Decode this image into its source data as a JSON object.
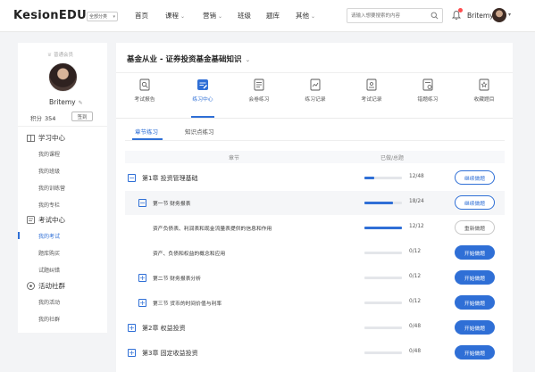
{
  "header": {
    "logo": "KesionEDU",
    "category_select": "全部分类",
    "nav": [
      {
        "label": "首页",
        "has_menu": false
      },
      {
        "label": "课程",
        "has_menu": true
      },
      {
        "label": "营销",
        "has_menu": true
      },
      {
        "label": "班级",
        "has_menu": false
      },
      {
        "label": "题库",
        "has_menu": false
      },
      {
        "label": "其他",
        "has_menu": true
      }
    ],
    "search_placeholder": "请输入想要搜索的内容",
    "username": "Britemy"
  },
  "sidebar": {
    "vip_label": "普通会员",
    "username": "Britemy",
    "points_label": "积分",
    "points_value": "354",
    "checkin_label": "签到",
    "sections": [
      {
        "title": "学习中心",
        "icon": "book-icon",
        "items": [
          "我的课程",
          "我的班级",
          "我的训练营",
          "我的专栏"
        ]
      },
      {
        "title": "考试中心",
        "icon": "exam-icon",
        "items": [
          "我的考试",
          "题库购买",
          "试题纠错"
        ]
      },
      {
        "title": "活动社群",
        "icon": "community-icon",
        "items": [
          "我的活动",
          "我的社群"
        ]
      }
    ],
    "active_item": "我的考试"
  },
  "main": {
    "course_title": "基金从业 - 证券投资基金基础知识",
    "icon_tabs": [
      {
        "label": "考试报告",
        "icon": "report-icon"
      },
      {
        "label": "练习中心",
        "icon": "practice-icon"
      },
      {
        "label": "会卷练习",
        "icon": "paper-icon"
      },
      {
        "label": "练习记录",
        "icon": "record-icon"
      },
      {
        "label": "考试记录",
        "icon": "exam-record-icon"
      },
      {
        "label": "错题练习",
        "icon": "wrong-icon"
      },
      {
        "label": "收藏题目",
        "icon": "bookmark-icon"
      }
    ],
    "active_icon_tab": "练习中心",
    "sub_tabs": [
      "章节练习",
      "知识点练习"
    ],
    "active_sub_tab": "章节练习",
    "table_headers": {
      "chapter": "章节",
      "progress": "已做/总题"
    },
    "rows": [
      {
        "level": 1,
        "expander": "−",
        "name": "第1章 投资管理基础",
        "done": 12,
        "total": 48,
        "count": "12/48",
        "button": "继续做题",
        "button_type": "continue",
        "shade": false
      },
      {
        "level": 2,
        "expander": "−",
        "name": "第一节 财务报表",
        "done": 18,
        "total": 24,
        "count": "18/24",
        "button": "继续做题",
        "button_type": "continue",
        "shade": true
      },
      {
        "level": 3,
        "expander": "",
        "name": "资产负债表、利润表和现金流量表提供的信息和作用",
        "done": 12,
        "total": 12,
        "count": "12/12",
        "button": "重新做题",
        "button_type": "redo",
        "shade": false
      },
      {
        "level": 3,
        "expander": "",
        "name": "资产、负债和权益的概念和应用",
        "done": 0,
        "total": 12,
        "count": "0/12",
        "button": "开始做题",
        "button_type": "start",
        "shade": false
      },
      {
        "level": 2,
        "expander": "+",
        "name": "第二节 财务报表分析",
        "done": 0,
        "total": 12,
        "count": "0/12",
        "button": "开始做题",
        "button_type": "start",
        "shade": false
      },
      {
        "level": 2,
        "expander": "+",
        "name": "第三节 货币的时间价值与利率",
        "done": 0,
        "total": 12,
        "count": "0/12",
        "button": "开始做题",
        "button_type": "start",
        "shade": false
      },
      {
        "level": 1,
        "expander": "+",
        "name": "第2章 权益投资",
        "done": 0,
        "total": 48,
        "count": "0/48",
        "button": "开始做题",
        "button_type": "start",
        "shade": false
      },
      {
        "level": 1,
        "expander": "+",
        "name": "第3章 固定收益投资",
        "done": 0,
        "total": 48,
        "count": "0/48",
        "button": "开始做题",
        "button_type": "start",
        "shade": false
      }
    ]
  },
  "colors": {
    "accent": "#2f6fd6",
    "background": "#f3f4f6",
    "notification": "#ff4d4f"
  }
}
